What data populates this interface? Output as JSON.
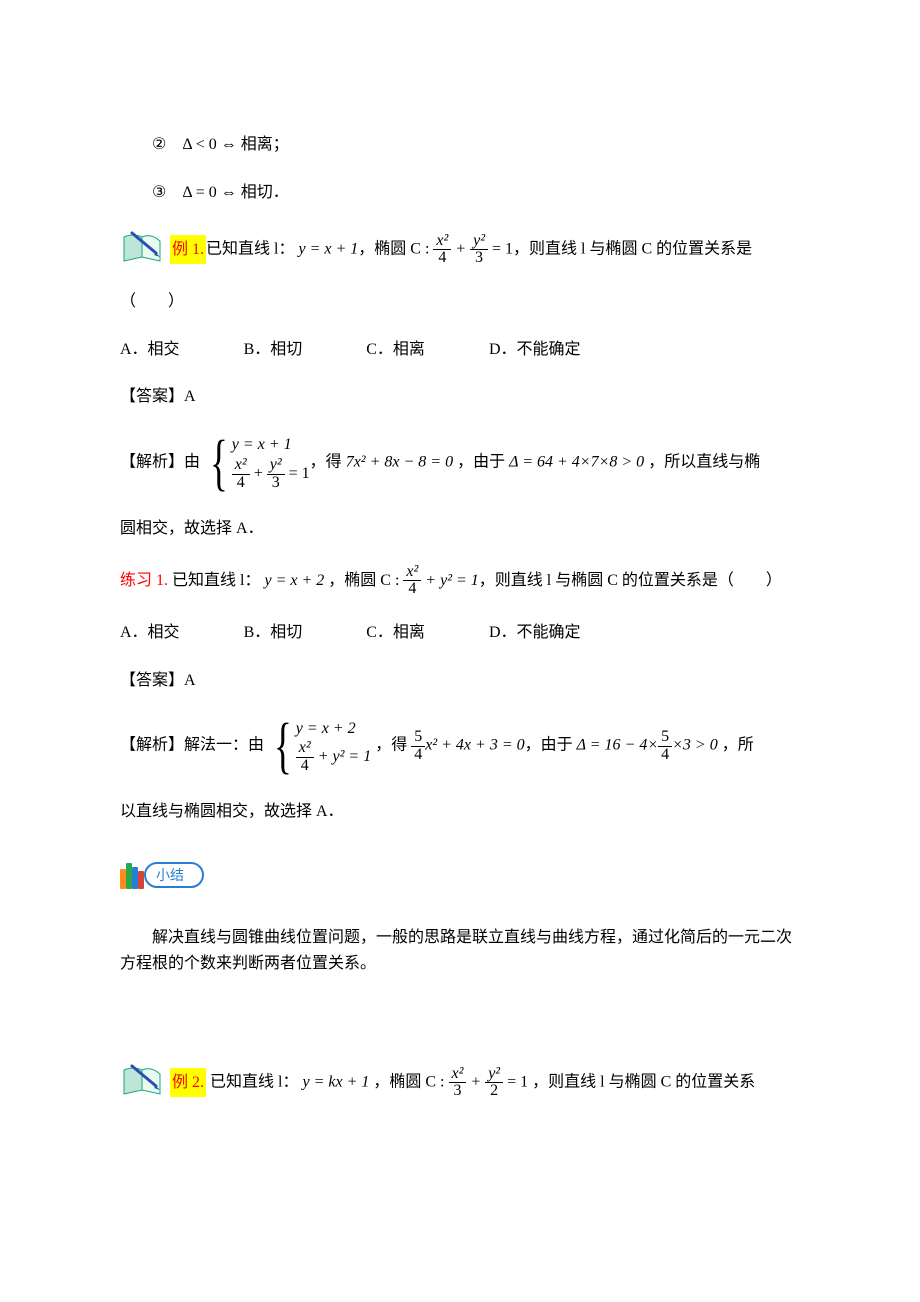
{
  "rules": {
    "item2": "②　Δ < 0 ⇔ 相离；",
    "item3": "③　Δ = 0 ⇔ 相切．"
  },
  "example1": {
    "label": "例 1.",
    "stem_prefix": "已知直线 l：",
    "line_eq": "y = x + 1",
    "ellipse_prefix": "，椭圆 C : ",
    "ellipse_frac1_num": "x²",
    "ellipse_frac1_den": "4",
    "ellipse_plus": " + ",
    "ellipse_frac2_num": "y²",
    "ellipse_frac2_den": "3",
    "ellipse_eq": " = 1",
    "stem_suffix": "，则直线 l 与椭圆 C 的位置关系是",
    "paren": "（　　）",
    "choices": {
      "A": "A．相交",
      "B": "B．相切",
      "C": "C．相离",
      "D": "D．不能确定"
    },
    "answer_tag": "【答案】",
    "answer_val": "A",
    "explain_tag": "【解析】",
    "explain_pre": "由",
    "sys_r1": "y = x + 1",
    "sys_r2_f1n": "x²",
    "sys_r2_f1d": "4",
    "sys_r2_f2n": "y²",
    "sys_r2_f2d": "3",
    "sys_r2_tail": " = 1",
    "explain_mid1": "，得 ",
    "quad": "7x² + 8x − 8 = 0",
    "explain_mid2": " ，由于 ",
    "delta": "Δ = 64 + 4×7×8 > 0",
    "explain_mid3": " ，所以直线与椭",
    "explain_tail": "圆相交，故选择 A．"
  },
  "practice1": {
    "label": "练习 1.",
    "stem_prefix": " 已知直线 l：",
    "line_eq": "y = x + 2",
    "ellipse_prefix": " ，椭圆 C : ",
    "ellipse_frac1_num": "x²",
    "ellipse_frac1_den": "4",
    "ellipse_plus": " + ",
    "ellipse_y2": "y² = 1",
    "stem_suffix": "，则直线 l 与椭圆 C 的位置关系是（　　）",
    "choices": {
      "A": "A．相交",
      "B": "B．相切",
      "C": "C．相离",
      "D": "D．不能确定"
    },
    "answer_tag": "【答案】",
    "answer_val": "A",
    "explain_tag": "【解析】",
    "explain_pre": "解法一：由",
    "sys_r1": "y = x + 2",
    "sys_r2_f1n": "x²",
    "sys_r2_f1d": "4",
    "sys_r2_tail": " + y² = 1",
    "explain_mid1": " ，得 ",
    "quad_f_n": "5",
    "quad_f_d": "4",
    "quad_tail": "x² + 4x + 3 = 0",
    "explain_mid2": "，由于 ",
    "delta_pre": "Δ = 16 − 4×",
    "delta_f_n": "5",
    "delta_f_d": "4",
    "delta_post": "×3 > 0",
    "explain_mid3": " ，所",
    "explain_tail": "以直线与椭圆相交，故选择 A．"
  },
  "summary": {
    "label": "小结",
    "text": "解决直线与圆锥曲线位置问题，一般的思路是联立直线与曲线方程，通过化简后的一元二次方程根的个数来判断两者位置关系。"
  },
  "example2": {
    "label": "例 2.",
    "stem_prefix": " 已知直线 l：",
    "line_eq": "y = kx + 1",
    "ellipse_prefix": " ，椭圆 C : ",
    "ellipse_frac1_num": "x²",
    "ellipse_frac1_den": "3",
    "ellipse_plus": " + ",
    "ellipse_frac2_num": "y²",
    "ellipse_frac2_den": "2",
    "ellipse_eq": " = 1",
    "stem_suffix": " ，则直线 l 与椭圆 C 的位置关系"
  }
}
